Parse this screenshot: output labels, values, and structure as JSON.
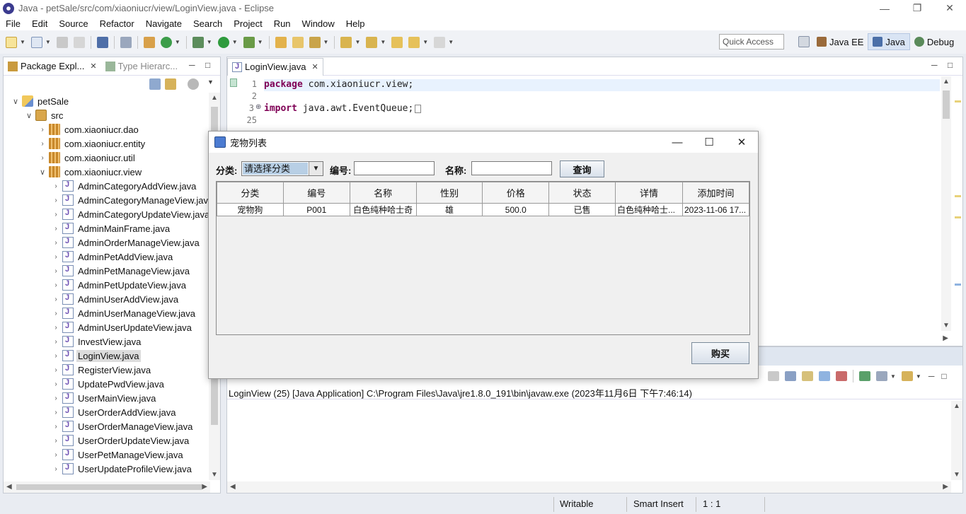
{
  "window": {
    "title": "Java - petSale/src/com/xiaoniucr/view/LoginView.java - Eclipse"
  },
  "menu": [
    "File",
    "Edit",
    "Source",
    "Refactor",
    "Navigate",
    "Search",
    "Project",
    "Run",
    "Window",
    "Help"
  ],
  "toolbar": {
    "quick_access": "Quick Access",
    "perspectives": [
      {
        "label": "Java EE",
        "active": false
      },
      {
        "label": "Java",
        "active": true
      },
      {
        "label": "Debug",
        "active": false
      }
    ]
  },
  "package_explorer": {
    "tab_active": "Package Expl...",
    "tab_inactive": "Type Hierarc...",
    "tree": [
      {
        "label": "petSale",
        "depth": 0,
        "kind": "project",
        "expanded": true
      },
      {
        "label": "src",
        "depth": 1,
        "kind": "src",
        "expanded": true
      },
      {
        "label": "com.xiaoniucr.dao",
        "depth": 2,
        "kind": "package",
        "expanded": false
      },
      {
        "label": "com.xiaoniucr.entity",
        "depth": 2,
        "kind": "package",
        "expanded": false
      },
      {
        "label": "com.xiaoniucr.util",
        "depth": 2,
        "kind": "package",
        "expanded": false
      },
      {
        "label": "com.xiaoniucr.view",
        "depth": 2,
        "kind": "package",
        "expanded": true
      },
      {
        "label": "AdminCategoryAddView.java",
        "depth": 3,
        "kind": "java"
      },
      {
        "label": "AdminCategoryManageView.java",
        "depth": 3,
        "kind": "java"
      },
      {
        "label": "AdminCategoryUpdateView.java",
        "depth": 3,
        "kind": "java"
      },
      {
        "label": "AdminMainFrame.java",
        "depth": 3,
        "kind": "java"
      },
      {
        "label": "AdminOrderManageView.java",
        "depth": 3,
        "kind": "java"
      },
      {
        "label": "AdminPetAddView.java",
        "depth": 3,
        "kind": "java"
      },
      {
        "label": "AdminPetManageView.java",
        "depth": 3,
        "kind": "java"
      },
      {
        "label": "AdminPetUpdateView.java",
        "depth": 3,
        "kind": "java"
      },
      {
        "label": "AdminUserAddView.java",
        "depth": 3,
        "kind": "java"
      },
      {
        "label": "AdminUserManageView.java",
        "depth": 3,
        "kind": "java"
      },
      {
        "label": "AdminUserUpdateView.java",
        "depth": 3,
        "kind": "java"
      },
      {
        "label": "InvestView.java",
        "depth": 3,
        "kind": "java"
      },
      {
        "label": "LoginView.java",
        "depth": 3,
        "kind": "java",
        "selected": true
      },
      {
        "label": "RegisterView.java",
        "depth": 3,
        "kind": "java"
      },
      {
        "label": "UpdatePwdView.java",
        "depth": 3,
        "kind": "java"
      },
      {
        "label": "UserMainView.java",
        "depth": 3,
        "kind": "java"
      },
      {
        "label": "UserOrderAddView.java",
        "depth": 3,
        "kind": "java"
      },
      {
        "label": "UserOrderManageView.java",
        "depth": 3,
        "kind": "java"
      },
      {
        "label": "UserOrderUpdateView.java",
        "depth": 3,
        "kind": "java"
      },
      {
        "label": "UserPetManageView.java",
        "depth": 3,
        "kind": "java"
      },
      {
        "label": "UserUpdateProfileView.java",
        "depth": 3,
        "kind": "java"
      }
    ]
  },
  "editor": {
    "tab": "LoginView.java",
    "lines": [
      {
        "num": "1",
        "keyword": "package",
        "rest": " com.xiaoniucr.view;"
      },
      {
        "num": "2",
        "keyword": "",
        "rest": ""
      },
      {
        "num": "3",
        "keyword": "import",
        "rest": " java.awt.EventQueue;"
      },
      {
        "num": "25",
        "keyword": "",
        "rest": ""
      }
    ]
  },
  "console": {
    "description": "LoginView (25) [Java Application] C:\\Program Files\\Java\\jre1.8.0_191\\bin\\javaw.exe (2023年11月6日 下午7:46:14)"
  },
  "statusbar": {
    "writable": "Writable",
    "insert_mode": "Smart Insert",
    "position": "1 : 1"
  },
  "dialog": {
    "title": "宠物列表",
    "category_label": "分类:",
    "category_value": "请选择分类",
    "number_label": "编号:",
    "number_value": "",
    "name_label": "名称:",
    "name_value": "",
    "search_button": "查询",
    "buy_button": "购买",
    "table": {
      "headers": [
        "分类",
        "编号",
        "名称",
        "性别",
        "价格",
        "状态",
        "详情",
        "添加时间"
      ],
      "rows": [
        [
          "宠物狗",
          "P001",
          "白色纯种哈士奇",
          "雄",
          "500.0",
          "已售",
          "白色纯种哈士...",
          "2023-11-06 17..."
        ]
      ]
    }
  }
}
